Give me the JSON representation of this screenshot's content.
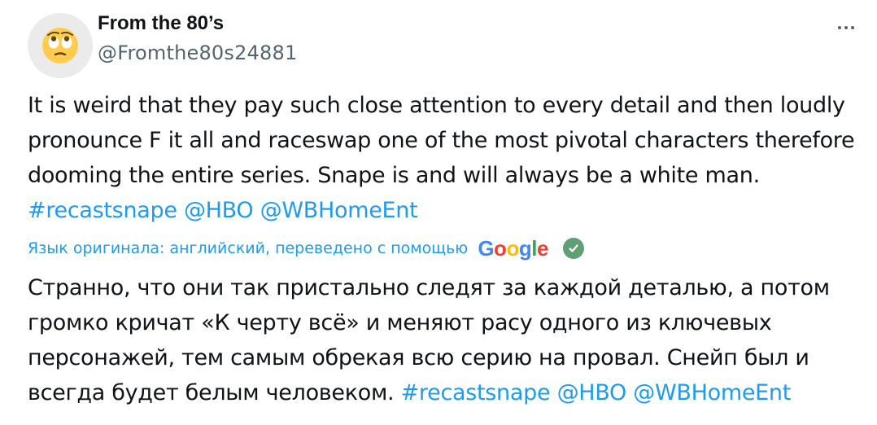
{
  "author": {
    "display_name": "From the 80’s",
    "handle": "@Fromthe80s24881",
    "avatar_icon": "face-with-rolling-eyes-emoji"
  },
  "tweet": {
    "text_plain": "It is weird that they pay such close attention to every detail and then loudly pronounce F it all and raceswap one of the most pivotal characters therefore dooming the entire series. Snape is and will always be a white man.",
    "hashtag": "#recastsnape",
    "mention_1": "@HBO",
    "mention_2": "@WBHomeEnt"
  },
  "translation": {
    "notice": "Язык оригинала: английский, переведено с помощью",
    "provider": "Google",
    "text_plain": "Странно, что они так пристально следят за каждой деталью, а потом громко кричат «К черту всё» и меняют расу одного из ключевых персонажей, тем самым обрекая всю серию на провал. Снейп был и всегда будет белым человеком.",
    "hashtag": "#recastsnape",
    "mention_1": "@HBO",
    "mention_2": "@WBHomeEnt"
  },
  "colors": {
    "link": "#1d9bf0",
    "secondary_text": "#536471",
    "primary_text": "#0f1419",
    "check_badge": "#5f9f74"
  },
  "icons": [
    "face-with-rolling-eyes-emoji",
    "more-horizontal-icon",
    "google-logo",
    "check-circle-icon"
  ]
}
